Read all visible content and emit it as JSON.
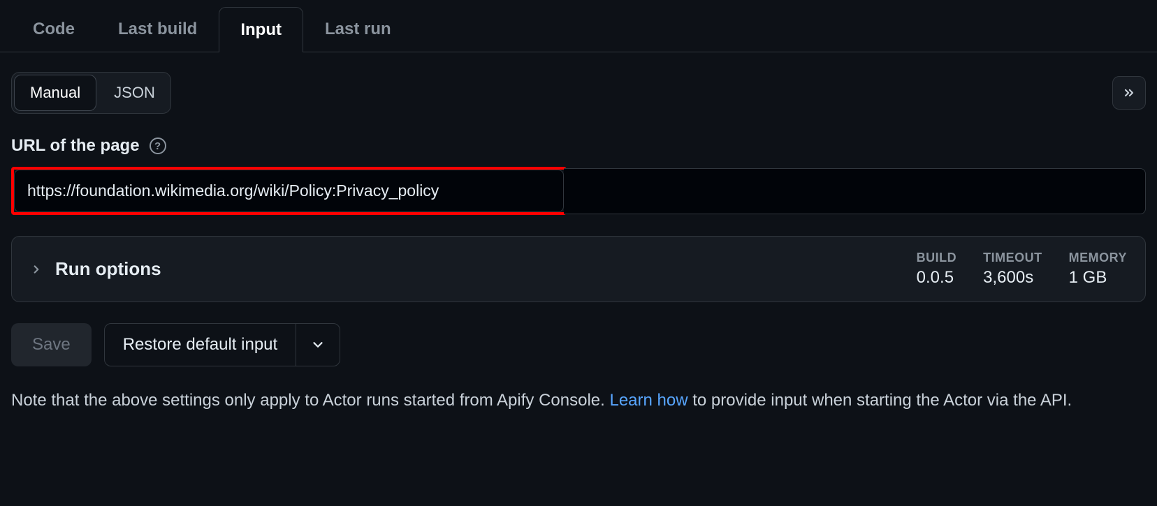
{
  "tabs": [
    {
      "label": "Code",
      "active": false
    },
    {
      "label": "Last build",
      "active": false
    },
    {
      "label": "Input",
      "active": true
    },
    {
      "label": "Last run",
      "active": false
    }
  ],
  "mode": {
    "manual_label": "Manual",
    "json_label": "JSON"
  },
  "field": {
    "label": "URL of the page",
    "value": "https://foundation.wikimedia.org/wiki/Policy:Privacy_policy"
  },
  "run_options": {
    "title": "Run options",
    "build": {
      "label": "BUILD",
      "value": "0.0.5"
    },
    "timeout": {
      "label": "TIMEOUT",
      "value": "3,600s"
    },
    "memory": {
      "label": "MEMORY",
      "value": "1 GB"
    }
  },
  "actions": {
    "save_label": "Save",
    "restore_label": "Restore default input"
  },
  "note": {
    "prefix": "Note that the above settings only apply to Actor runs started from Apify Console. ",
    "link_text": "Learn how",
    "suffix": " to provide input when starting the Actor via the API."
  }
}
